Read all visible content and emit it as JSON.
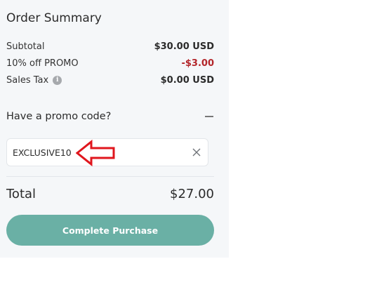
{
  "summary": {
    "title": "Order Summary",
    "subtotal_label": "Subtotal",
    "subtotal_value": "$30.00 USD",
    "promo_label": "10% off PROMO",
    "promo_value": "-$3.00",
    "tax_label": "Sales Tax",
    "tax_info_icon": "i",
    "tax_value": "$0.00 USD"
  },
  "promo": {
    "heading": "Have a promo code?",
    "code_value": "EXCLUSIVE10"
  },
  "total": {
    "label": "Total",
    "value": "$27.00"
  },
  "cta": {
    "label": "Complete Purchase"
  },
  "colors": {
    "panel_bg": "#f5f7f9",
    "discount": "#b3262a",
    "cta_bg": "#6ab0a5",
    "annotation_arrow": "#e0161d"
  },
  "icons": [
    "info-icon",
    "collapse-icon",
    "clear-icon",
    "arrow-annotation-icon"
  ]
}
